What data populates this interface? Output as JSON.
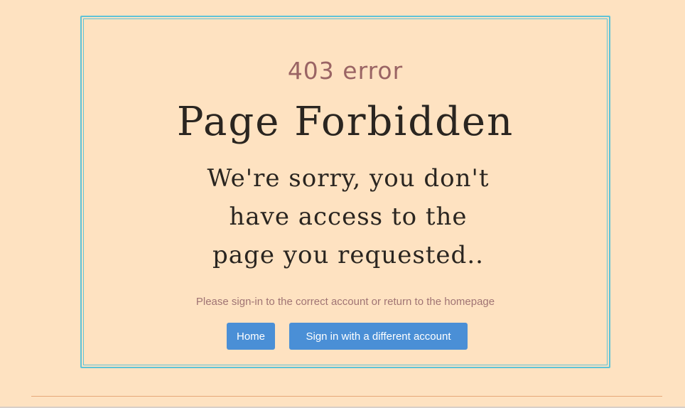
{
  "error": {
    "code": "403 error",
    "title": "Page Forbidden",
    "message": "We're sorry, you don't have access to the page you requested..",
    "instruction": "Please sign-in to the correct account or return to the homepage"
  },
  "actions": {
    "home_label": "Home",
    "signin_label": "Sign in with a different account"
  },
  "colors": {
    "background": "#fee2c1",
    "panel_border": "#5fc3d6",
    "button": "#4a8fd6",
    "error_code": "#9a6464",
    "footer_rule": "#e6a878"
  }
}
